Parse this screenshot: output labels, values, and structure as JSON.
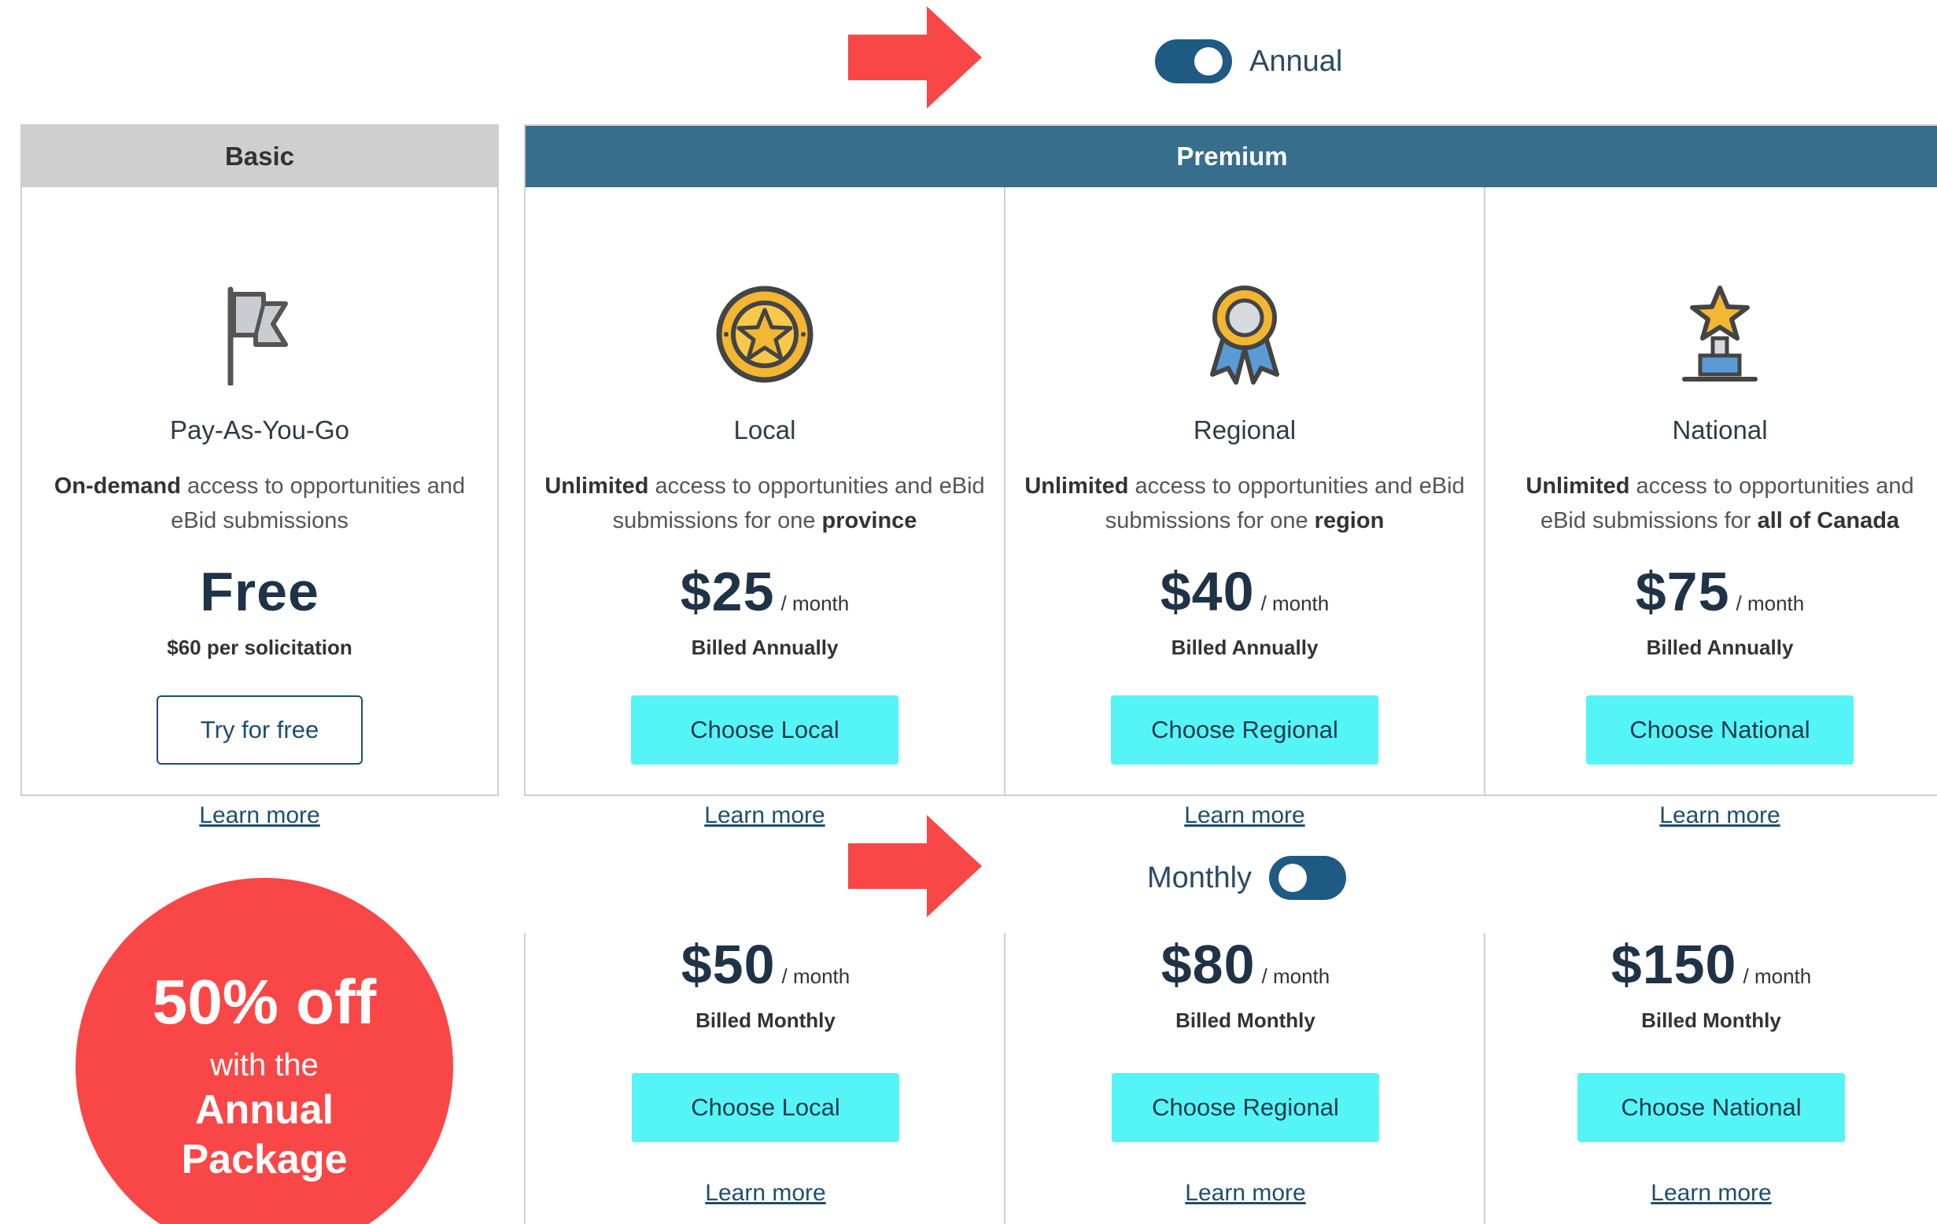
{
  "colors": {
    "arrow": "#f94747",
    "toggle": "#1e5a82",
    "premium_header": "#366e8c",
    "cta": "#55f5f7",
    "badge": "#f94747"
  },
  "annual_toggle": {
    "label": "Annual",
    "state": "on"
  },
  "monthly_toggle": {
    "label": "Monthly",
    "state": "off"
  },
  "basic": {
    "header": "Basic",
    "plan": {
      "name": "Pay-As-You-Go",
      "desc_bold": "On-demand",
      "desc_rest": " access to opportunities and eBid submissions",
      "price": "Free",
      "note": "$60 per solicitation",
      "button": "Try for free",
      "learn": "Learn more",
      "icon": "flag-icon"
    }
  },
  "premium": {
    "header": "Premium",
    "plans": [
      {
        "name": "Local",
        "desc_bold": "Unlimited",
        "desc_mid": " access to opportunities and eBid submissions for one ",
        "desc_end": "province",
        "price": "$25",
        "per": "/ month",
        "billed": "Billed Annually",
        "button": "Choose Local",
        "learn": "Learn more",
        "icon": "star-medal-icon"
      },
      {
        "name": "Regional",
        "desc_bold": "Unlimited",
        "desc_mid": " access to opportunities and eBid submissions for one ",
        "desc_end": "region",
        "price": "$40",
        "per": "/ month",
        "billed": "Billed Annually",
        "button": "Choose Regional",
        "learn": "Learn more",
        "icon": "ribbon-award-icon"
      },
      {
        "name": "National",
        "desc_bold": "Unlimited",
        "desc_mid": " access to opportunities and eBid submissions for ",
        "desc_end": "all of Canada",
        "price": "$75",
        "per": "/ month",
        "billed": "Billed Annually",
        "button": "Choose National",
        "learn": "Learn more",
        "icon": "trophy-icon"
      }
    ]
  },
  "monthly": {
    "plans": [
      {
        "price": "$50",
        "per": "/ month",
        "billed": "Billed Monthly",
        "button": "Choose Local",
        "learn": "Learn more"
      },
      {
        "price": "$80",
        "per": "/ month",
        "billed": "Billed Monthly",
        "button": "Choose Regional",
        "learn": "Learn more"
      },
      {
        "price": "$150",
        "per": "/ month",
        "billed": "Billed Monthly",
        "button": "Choose National",
        "learn": "Learn more"
      }
    ]
  },
  "badge": {
    "line1": "50% off",
    "line2": "with the",
    "line3": "Annual",
    "line4": "Package"
  }
}
